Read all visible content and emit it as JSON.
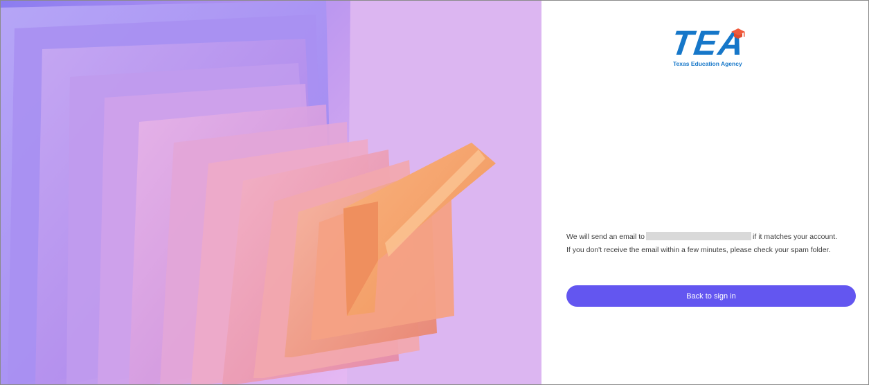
{
  "logo": {
    "mark": "TEA",
    "subtitle": "Texas Education Agency",
    "icon": "graduation-cap-icon",
    "brand_color": "#1677c9",
    "accent_color": "#f05a3c"
  },
  "message": {
    "line1_prefix": "We will send an email to",
    "line1_suffix": "if it matches your account.",
    "line2": "If you don't receive the email within a few minutes, please check your spam folder."
  },
  "actions": {
    "back_label": "Back to sign in",
    "button_color": "#6356f0"
  },
  "hero": {
    "background_color": "#dcb6f1"
  }
}
